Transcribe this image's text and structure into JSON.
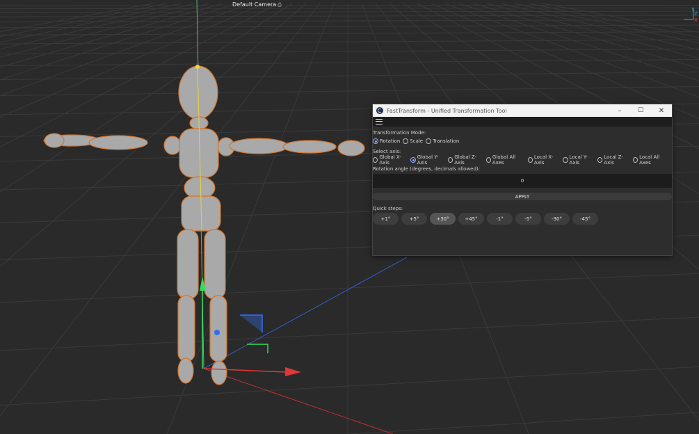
{
  "viewport": {
    "camera_label": "Default Camera",
    "camera_icon": "camera-icon",
    "axis_labels": {
      "y": "Y",
      "z": "Z",
      "x": "X"
    }
  },
  "dialog": {
    "title": "FastTransform - Unified Transformation Tool",
    "controls": {
      "minimize": "–",
      "maximize": "☐",
      "close": "✕"
    },
    "menu_icon": "hamburger-menu-icon",
    "mode_label": "Transformation Mode:",
    "modes": [
      {
        "label": "Rotation",
        "checked": true
      },
      {
        "label": "Scale",
        "checked": false
      },
      {
        "label": "Translation",
        "checked": false
      }
    ],
    "axis_label": "Select axis:",
    "axes": [
      {
        "label": "Global X-Axis",
        "checked": false
      },
      {
        "label": "Global Y-Axis",
        "checked": true
      },
      {
        "label": "Global Z-Axis",
        "checked": false
      },
      {
        "label": "Global All Axes",
        "checked": false
      },
      {
        "label": "Local X-Axis",
        "checked": false
      },
      {
        "label": "Local Y-Axis",
        "checked": false
      },
      {
        "label": "Local Z-Axis",
        "checked": false
      },
      {
        "label": "Local All Axes",
        "checked": false
      }
    ],
    "angle_label": "Rotation angle (degrees, decimals allowed):",
    "angle_value": "0",
    "apply_label": "APPLY",
    "steps_label": "Quick steps:",
    "steps": [
      {
        "label": "+1°",
        "active": false
      },
      {
        "label": "+5°",
        "active": false
      },
      {
        "label": "+30°",
        "active": true
      },
      {
        "label": "+45°",
        "active": false
      },
      {
        "label": "-1°",
        "active": false
      },
      {
        "label": "-5°",
        "active": false
      },
      {
        "label": "-30°",
        "active": false
      },
      {
        "label": "-45°",
        "active": false
      }
    ],
    "accent_color": "#8fa6ff"
  }
}
